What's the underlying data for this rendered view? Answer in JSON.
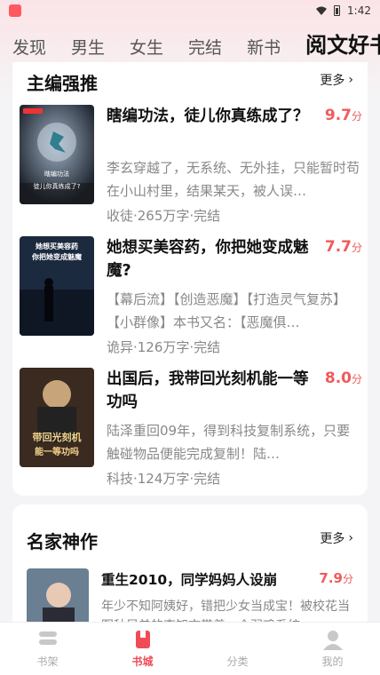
{
  "status": {
    "time": "1:42"
  },
  "tabs": [
    {
      "label": "发现"
    },
    {
      "label": "男生"
    },
    {
      "label": "女生"
    },
    {
      "label": "完结"
    },
    {
      "label": "新书"
    },
    {
      "label": "阅文好书"
    }
  ],
  "section1": {
    "title": "主编强推",
    "more": "更多",
    "books": [
      {
        "title": "瞎编功法，徒儿你真练成了？",
        "score": "9.7",
        "score_unit": "分",
        "desc": "李玄穿越了，无系统、无外挂，只能暂时苟在小山村里，结果某天，被人误…",
        "meta": "收徒·265万字·完结",
        "cover_text": "瞎编功法\n徒儿你真练成了?",
        "cover_badge": "阅读咪书"
      },
      {
        "title": "她想买美容药，你把她变成魅魔?",
        "score": "7.7",
        "score_unit": "分",
        "desc": "【幕后流】【创造恶魔】【打造灵气复苏】【小群像】本书又名：【恶魔俱…",
        "meta": "诡异·126万字·完结",
        "cover_text": "她想买美容药\n你把她变成魅魔"
      },
      {
        "title": "出国后，我带回光刻机能一等功吗",
        "score": "8.0",
        "score_unit": "分",
        "desc": "陆泽重回09年，得到科技复制系统，只要触碰物品便能完成复制！陆…",
        "meta": "科技·124万字·完结",
        "cover_text": "带回光刻机\n能一等功吗"
      }
    ]
  },
  "section2": {
    "title": "名家神作",
    "more": "更多",
    "book": {
      "title": "重生2010，同学妈妈人设崩",
      "score": "7.9",
      "score_unit": "分",
      "desc": "年少不知阿姨好，错把少女当成宝！被校花当冤种兄弟的李知言带着一个弱鸡系统…"
    }
  },
  "nav": [
    {
      "label": "书架",
      "icon": "bookshelf-icon"
    },
    {
      "label": "书城",
      "icon": "bookstore-icon"
    },
    {
      "label": "分类",
      "icon": "category-icon"
    },
    {
      "label": "我的",
      "icon": "profile-icon"
    }
  ],
  "colors": {
    "accent": "#f04a55",
    "score": "#f05a5a"
  }
}
